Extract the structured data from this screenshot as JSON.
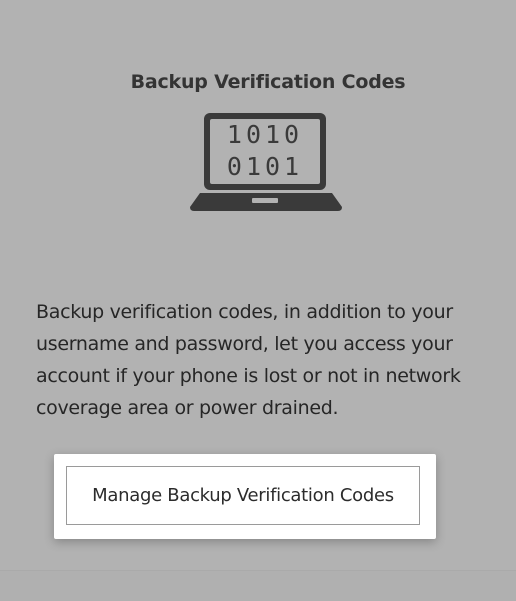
{
  "section": {
    "title": "Backup Verification Codes",
    "icon": "laptop-binary-icon",
    "icon_code_lines": [
      "1010",
      "0101"
    ],
    "description": "Backup verification codes, in addition to your username and password, let you access your account if your phone is lost or not in network coverage area or power drained.",
    "manage_button_label": "Manage Backup Verification Codes"
  },
  "colors": {
    "background": "#b2b2b2",
    "icon": "#3a3a3a",
    "button_bg": "#ffffff",
    "button_border": "#9a9a9a"
  }
}
